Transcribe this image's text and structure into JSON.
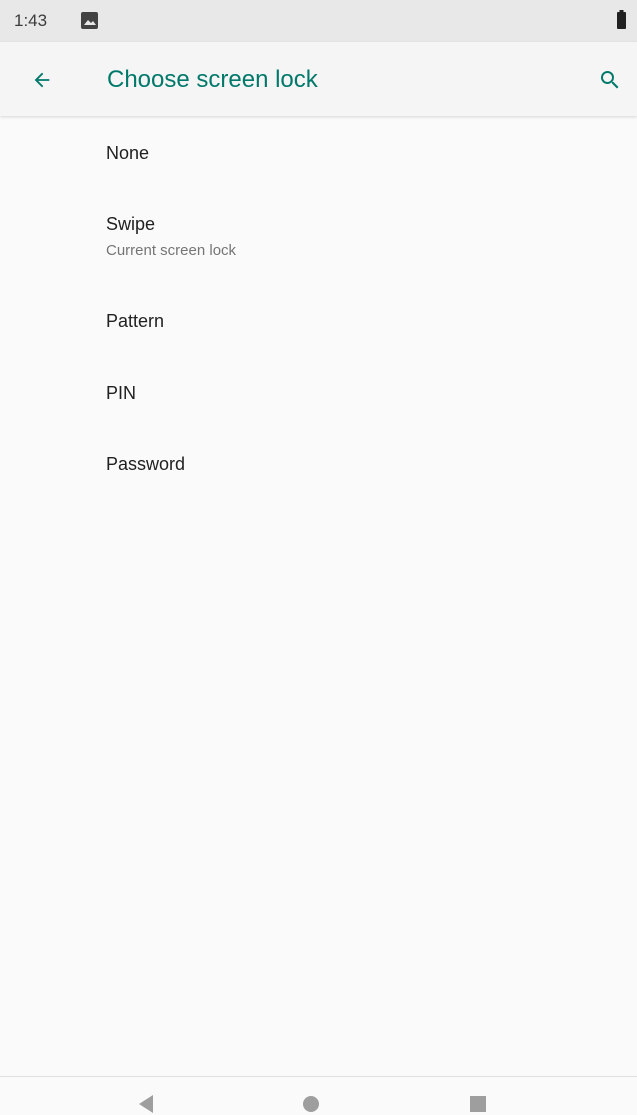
{
  "status_bar": {
    "time": "1:43",
    "icons": [
      "image-icon",
      "battery-icon"
    ]
  },
  "app_bar": {
    "title": "Choose screen lock",
    "back_icon": "arrow-back-icon",
    "search_icon": "search-icon",
    "accent_color": "#00796b"
  },
  "options": [
    {
      "title": "None",
      "subtitle": ""
    },
    {
      "title": "Swipe",
      "subtitle": "Current screen lock"
    },
    {
      "title": "Pattern",
      "subtitle": ""
    },
    {
      "title": "PIN",
      "subtitle": ""
    },
    {
      "title": "Password",
      "subtitle": ""
    }
  ],
  "nav_bar": {
    "icons": [
      "nav-back-icon",
      "nav-home-icon",
      "nav-recents-icon"
    ]
  }
}
